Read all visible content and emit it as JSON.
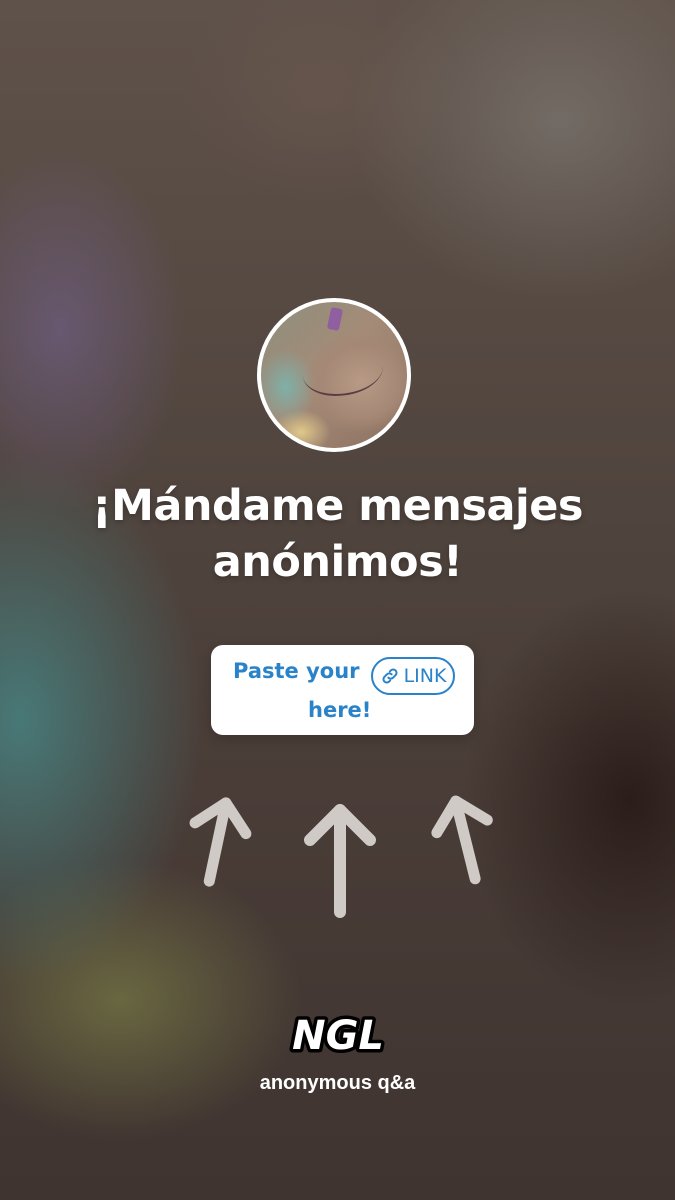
{
  "headline": {
    "line1": "¡Mándame mensajes",
    "line2": "anónimos!"
  },
  "paste_card": {
    "text_line1": "Paste your",
    "text_line2": "here!",
    "link_label": "LINK",
    "link_icon": "link-icon",
    "text_color": "#2a82c9"
  },
  "arrows": {
    "icon": "arrow-up-icon",
    "count": 3
  },
  "brand": {
    "logo_text": "NGL",
    "tagline": "anonymous q&a"
  }
}
